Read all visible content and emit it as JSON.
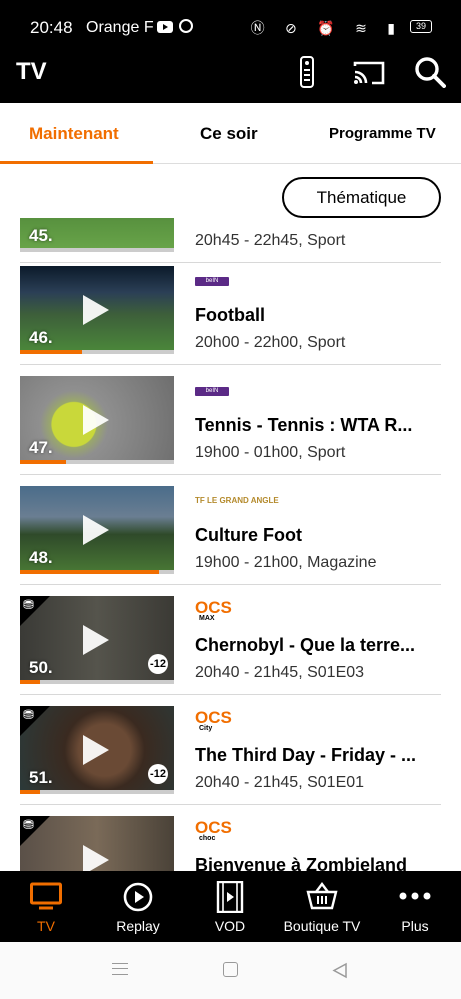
{
  "status_bar": {
    "time": "20:48",
    "operator": "Orange F",
    "icons": [
      "nfc-icon",
      "vibrate-icon",
      "alarm-icon",
      "wifi-icon",
      "signal-icon"
    ],
    "battery": "39"
  },
  "app": {
    "title": "TV",
    "icons": [
      "remote-icon",
      "cast-icon",
      "search-icon"
    ]
  },
  "tabs": [
    {
      "label": "Maintenant",
      "active": true
    },
    {
      "label": "Ce soir",
      "active": false
    },
    {
      "label": "Programme TV",
      "active": false
    }
  ],
  "filter": {
    "label": "Thématique"
  },
  "programs": [
    {
      "number": "45.",
      "channel_logo": "",
      "title": "",
      "time": "20h45 - 22h45, Sport",
      "progress": 0.0,
      "age": "",
      "shop": false
    },
    {
      "number": "46.",
      "channel_logo": "beIN SPORTS 2",
      "title": "Football",
      "time": "20h00 - 22h00, Sport",
      "progress": 0.4,
      "age": "",
      "shop": false
    },
    {
      "number": "47.",
      "channel_logo": "beIN SPORTS 3",
      "title": "Tennis - Tennis : WTA R...",
      "time": "19h00 - 01h00, Sport",
      "progress": 0.3,
      "age": "",
      "shop": false
    },
    {
      "number": "48.",
      "channel_logo": "TF LE GRAND ANGLE",
      "title": "Culture Foot",
      "time": "19h00 - 21h00, Magazine",
      "progress": 0.9,
      "age": "",
      "shop": false
    },
    {
      "number": "50.",
      "channel_logo": "OCS",
      "channel_sub": "MAX",
      "title": "Chernobyl - Que la terre...",
      "time": "20h40 - 21h45, S01E03",
      "progress": 0.13,
      "age": "-12",
      "shop": true
    },
    {
      "number": "51.",
      "channel_logo": "OCS",
      "channel_sub": "City",
      "title": "The Third Day - Friday - ...",
      "time": "20h40 - 21h45, S01E01",
      "progress": 0.13,
      "age": "-12",
      "shop": true
    },
    {
      "number": "",
      "channel_logo": "OCS",
      "channel_sub": "choc",
      "title": "Bienvenue à Zombieland",
      "time": "",
      "progress": 0.0,
      "age": "",
      "shop": true
    }
  ],
  "bottom_nav": [
    {
      "label": "TV",
      "icon": "tv-icon",
      "active": true
    },
    {
      "label": "Replay",
      "icon": "replay-icon",
      "active": false
    },
    {
      "label": "VOD",
      "icon": "film-icon",
      "active": false
    },
    {
      "label": "Boutique TV",
      "icon": "basket-icon",
      "active": false
    },
    {
      "label": "Plus",
      "icon": "more-icon",
      "active": false
    }
  ],
  "colors": {
    "accent": "#f16e00",
    "bar": "#000000"
  }
}
